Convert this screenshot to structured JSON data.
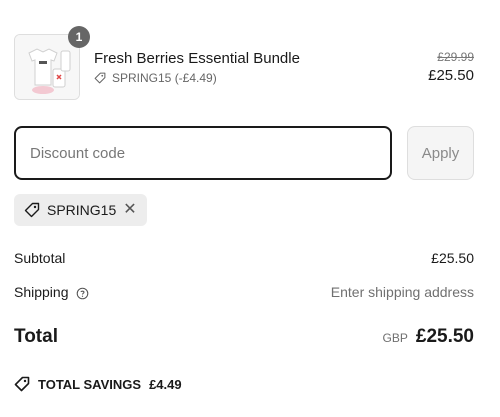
{
  "line_item": {
    "quantity": "1",
    "title": "Fresh Berries Essential Bundle",
    "discount_label": "SPRING15 (-£4.49)",
    "original_price": "£29.99",
    "price": "£25.50",
    "image_icon": "product-bundle-image"
  },
  "discount": {
    "placeholder": "Discount code",
    "value": "",
    "apply_label": "Apply",
    "applied_code": "SPRING15",
    "remove_icon": "close-icon"
  },
  "summary": {
    "subtotal_label": "Subtotal",
    "subtotal_value": "£25.50",
    "shipping_label": "Shipping",
    "shipping_value": "Enter shipping address",
    "total_label": "Total",
    "currency": "GBP",
    "total_value": "£25.50"
  },
  "savings": {
    "label": "TOTAL SAVINGS",
    "value": "£4.49"
  },
  "colors": {
    "text": "#1a1a1a",
    "muted": "#707070",
    "badge": "#666666",
    "tag_bg": "#ededed"
  }
}
